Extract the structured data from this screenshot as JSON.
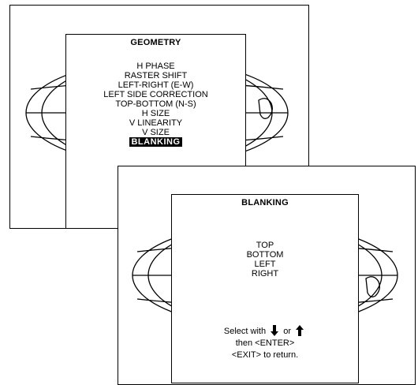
{
  "geometry_menu": {
    "title": "GEOMETRY",
    "items": [
      {
        "label": "H PHASE"
      },
      {
        "label": "RASTER SHIFT"
      },
      {
        "label": "LEFT-RIGHT (E-W)"
      },
      {
        "label": "LEFT SIDE CORRECTION"
      },
      {
        "label": "TOP-BOTTOM (N-S)"
      },
      {
        "label": "H SIZE"
      },
      {
        "label": "V LINEARITY"
      },
      {
        "label": "V SIZE"
      },
      {
        "label": "BLANKING",
        "selected": true
      }
    ]
  },
  "blanking_menu": {
    "title": "BLANKING",
    "items": [
      {
        "label": "TOP"
      },
      {
        "label": "BOTTOM"
      },
      {
        "label": "LEFT"
      },
      {
        "label": "RIGHT"
      }
    ],
    "instructions": {
      "select_prefix": "Select with",
      "select_or": "or",
      "enter": "then <ENTER>",
      "exit": "<EXIT> to return."
    }
  },
  "icons": [
    "globe-icon",
    "down-arrow-icon",
    "up-arrow-icon"
  ]
}
